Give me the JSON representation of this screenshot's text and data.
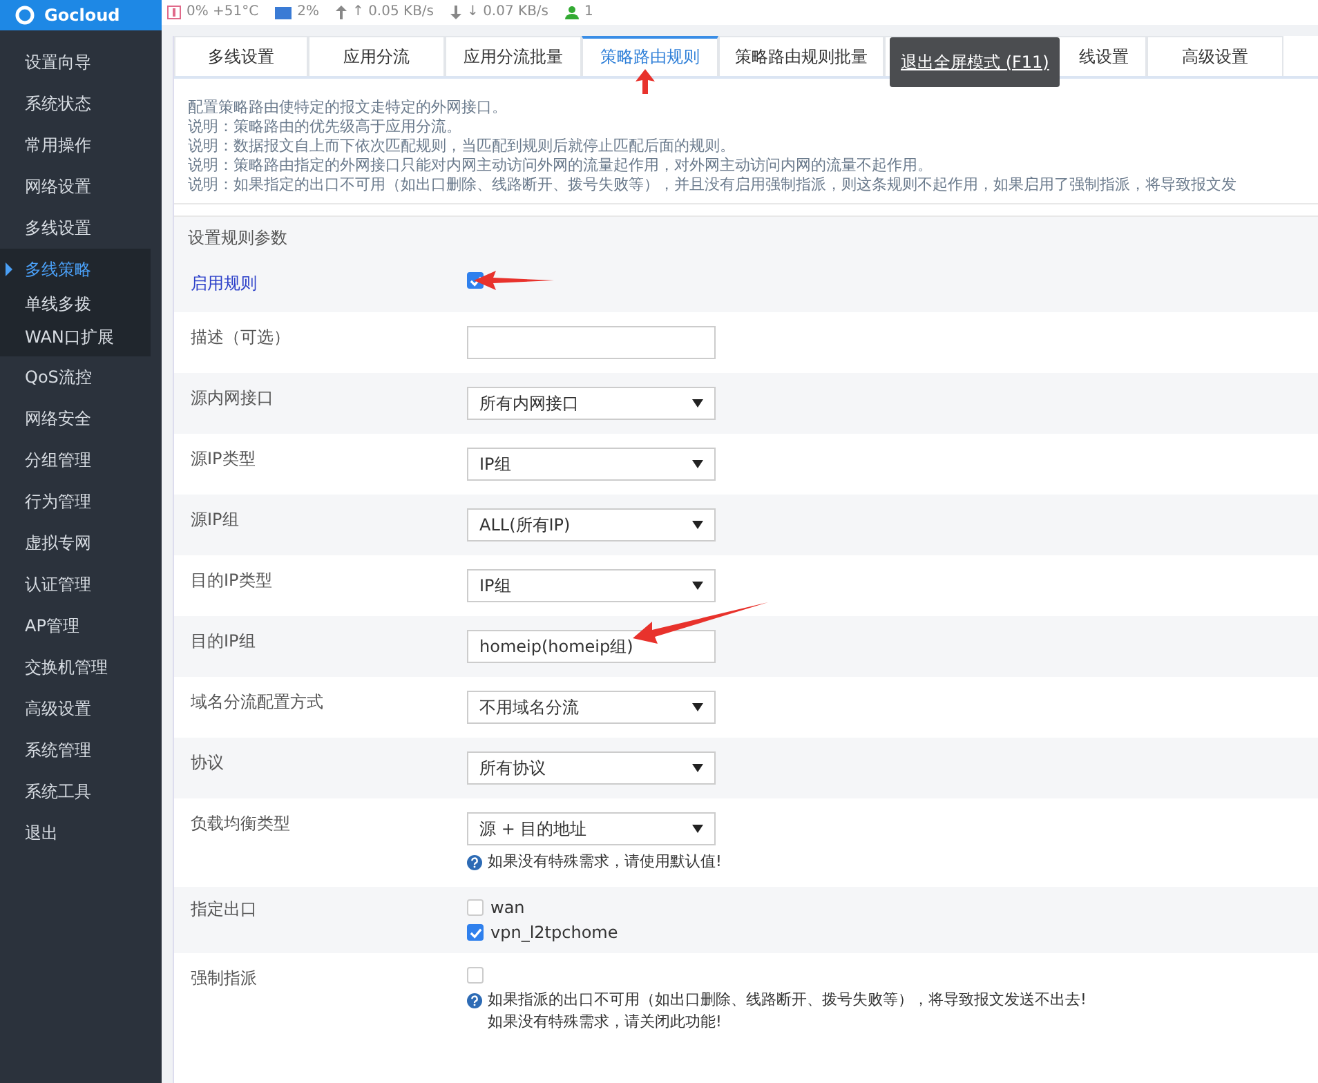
{
  "logo": {
    "text": "Gocloud"
  },
  "status_bar": [
    {
      "kind": "cpu",
      "text": "0% +51°C"
    },
    {
      "kind": "mem",
      "text": "2%"
    },
    {
      "kind": "up",
      "text": "↑ 0.05 KB/s"
    },
    {
      "kind": "down",
      "text": "↓ 0.07 KB/s"
    },
    {
      "kind": "users",
      "text": "1"
    }
  ],
  "sidebar": {
    "items": [
      {
        "label": "设置向导",
        "selected": false
      },
      {
        "label": "系统状态",
        "selected": false
      },
      {
        "label": "常用操作",
        "selected": false
      },
      {
        "label": "网络设置",
        "selected": false
      },
      {
        "label": "多线设置",
        "selected": false
      },
      {
        "label": "多线策略",
        "selected": true,
        "children": [
          {
            "label": "单线多拨"
          },
          {
            "label": "WAN口扩展"
          }
        ]
      },
      {
        "label": "QoS流控",
        "selected": false
      },
      {
        "label": "网络安全",
        "selected": false
      },
      {
        "label": "分组管理",
        "selected": false
      },
      {
        "label": "行为管理",
        "selected": false
      },
      {
        "label": "虚拟专网",
        "selected": false
      },
      {
        "label": "认证管理",
        "selected": false
      },
      {
        "label": "AP管理",
        "selected": false
      },
      {
        "label": "交换机管理",
        "selected": false
      },
      {
        "label": "高级设置",
        "selected": false
      },
      {
        "label": "系统管理",
        "selected": false
      },
      {
        "label": "系统工具",
        "selected": false
      },
      {
        "label": "退出",
        "selected": false
      }
    ]
  },
  "tabs": [
    {
      "label": "多线设置",
      "selected": false
    },
    {
      "label": "应用分流",
      "selected": false
    },
    {
      "label": "应用分流批量",
      "selected": false
    },
    {
      "label": "策略路由规则",
      "selected": true
    },
    {
      "label": "策略路由规则批量",
      "selected": false
    },
    {
      "label": "线设置",
      "selected": false
    },
    {
      "label": "高级设置",
      "selected": false
    }
  ],
  "fullscreen_tooltip": "退出全屏模式 (F11)",
  "description": [
    "配置策略路由使特定的报文走特定的外网接口。",
    "说明：策略路由的优先级高于应用分流。",
    "说明：数据报文自上而下依次匹配规则，当匹配到规则后就停止匹配后面的规则。",
    "说明：策略路由指定的外网接口只能对内网主动访问外网的流量起作用，对外网主动访问内网的流量不起作用。",
    "说明：如果指定的出口不可用（如出口删除、线路断开、拨号失败等），并且没有启用强制指派，则这条规则不起作用，如果启用了强制指派，将导致报文发"
  ],
  "section_title": "设置规则参数",
  "rows": [
    {
      "kind": "checkbox",
      "label": "启用规则",
      "checked": true,
      "highlight": true
    },
    {
      "kind": "text",
      "label": "描述（可选）",
      "value": ""
    },
    {
      "kind": "select",
      "label": "源内网接口",
      "value": "所有内网接口"
    },
    {
      "kind": "select",
      "label": "源IP类型",
      "value": "IP组"
    },
    {
      "kind": "select",
      "label": "源IP组",
      "value": "ALL(所有IP)"
    },
    {
      "kind": "select",
      "label": "目的IP类型",
      "value": "IP组"
    },
    {
      "kind": "text",
      "label": "目的IP组",
      "value": "homeip(homeip组)"
    },
    {
      "kind": "select",
      "label": "域名分流配置方式",
      "value": "不用域名分流"
    },
    {
      "kind": "select",
      "label": "协议",
      "value": "所有协议"
    },
    {
      "kind": "select",
      "label": "负载均衡类型",
      "value": "源 + 目的地址",
      "hint": [
        "如果没有特殊需求，请使用默认值!"
      ]
    },
    {
      "kind": "checklist",
      "label": "指定出口",
      "options": [
        {
          "label": "wan",
          "checked": false
        },
        {
          "label": "vpn_l2tpchome",
          "checked": true
        }
      ]
    },
    {
      "kind": "checkbox",
      "label": "强制指派",
      "checked": false,
      "hint": [
        "如果指派的出口不可用（如出口删除、线路断开、拨号失败等），将导致报文发送不出去!",
        "如果没有特殊需求，请关闭此功能!"
      ]
    }
  ]
}
